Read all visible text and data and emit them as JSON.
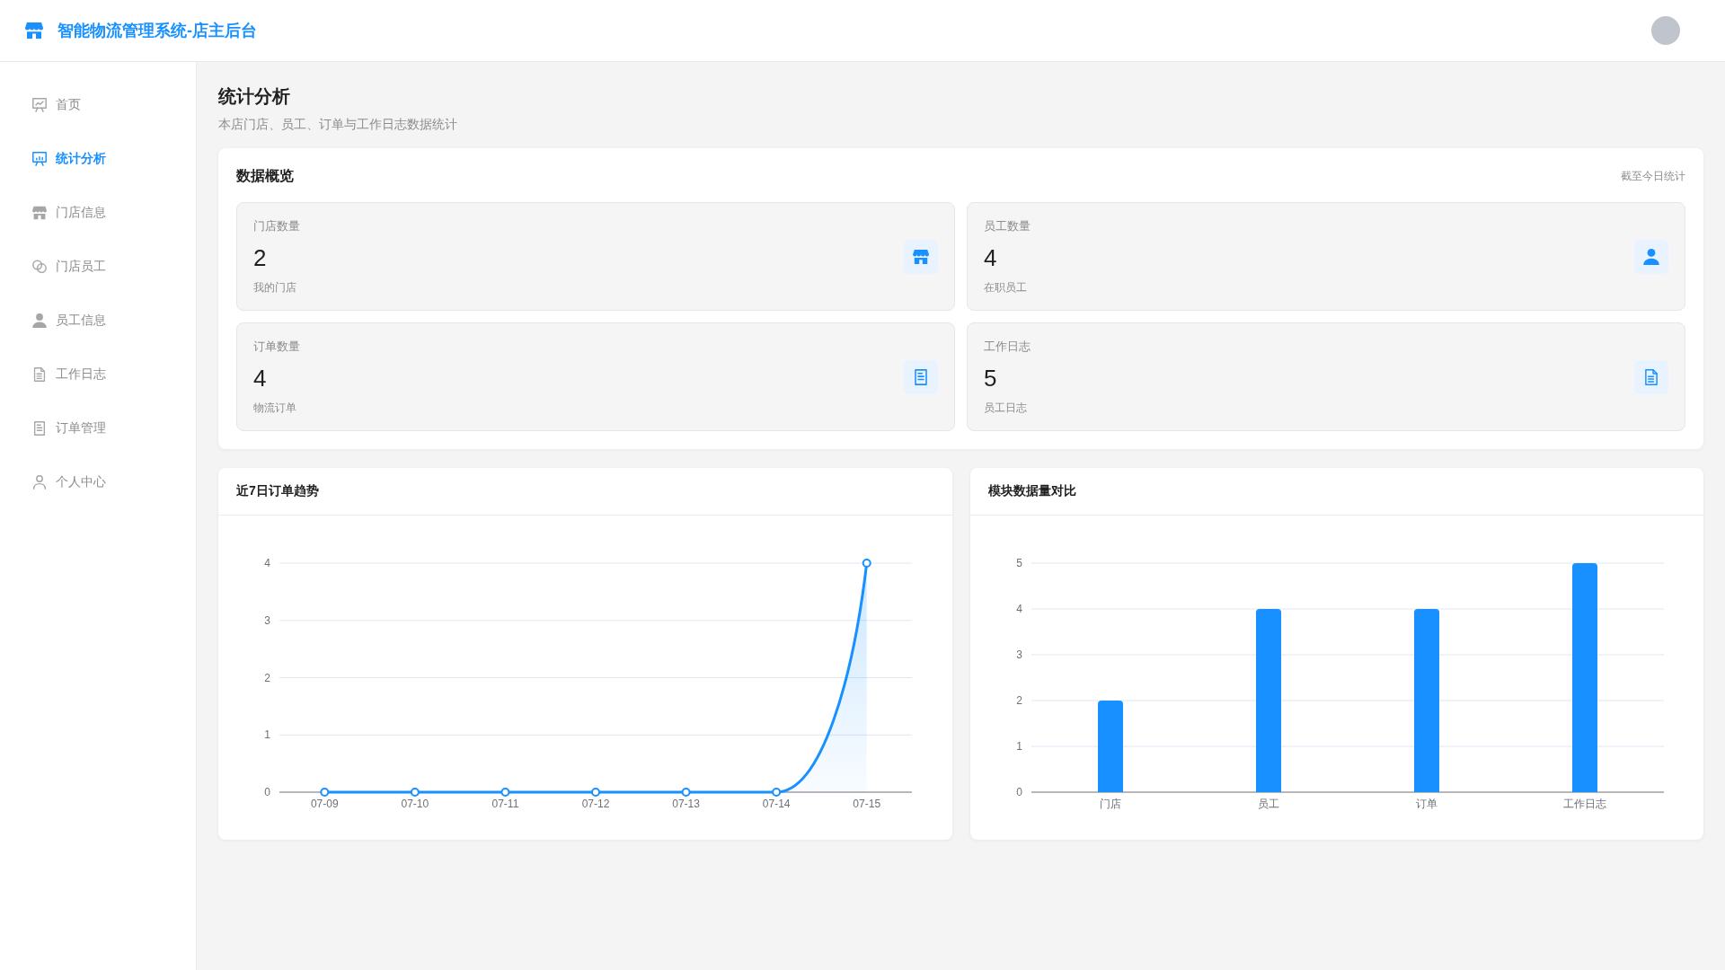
{
  "header": {
    "title": "智能物流管理系统-店主后台"
  },
  "sidebar": {
    "items": [
      {
        "label": "首页",
        "selected": false
      },
      {
        "label": "统计分析",
        "selected": true
      },
      {
        "label": "门店信息",
        "selected": false
      },
      {
        "label": "门店员工",
        "selected": false
      },
      {
        "label": "员工信息",
        "selected": false
      },
      {
        "label": "工作日志",
        "selected": false
      },
      {
        "label": "订单管理",
        "selected": false
      },
      {
        "label": "个人中心",
        "selected": false
      }
    ]
  },
  "page": {
    "title": "统计分析",
    "subtitle": "本店门店、员工、订单与工作日志数据统计"
  },
  "overview": {
    "title": "数据概览",
    "note": "截至今日统计",
    "stats": [
      {
        "label": "门店数量",
        "value": "2",
        "caption": "我的门店"
      },
      {
        "label": "员工数量",
        "value": "4",
        "caption": "在职员工"
      },
      {
        "label": "订单数量",
        "value": "4",
        "caption": "物流订单"
      },
      {
        "label": "工作日志",
        "value": "5",
        "caption": "员工日志"
      }
    ]
  },
  "charts": [
    {
      "title": "近7日订单趋势",
      "chart_data": {
        "type": "area",
        "categories": [
          "07-09",
          "07-10",
          "07-11",
          "07-12",
          "07-13",
          "07-14",
          "07-15"
        ],
        "series": [
          {
            "color": "#1890ff",
            "marker": "circle",
            "values": [
              0,
              0,
              0,
              0,
              0,
              0,
              4
            ]
          }
        ],
        "ylim": [
          0,
          4
        ],
        "yticks": [
          0,
          1,
          2,
          3,
          4
        ],
        "grid": true
      }
    },
    {
      "title": "模块数据量对比",
      "chart_data": {
        "type": "bar",
        "categories": [
          "门店",
          "员工",
          "订单",
          "工作日志"
        ],
        "series": [
          {
            "color": "#1890ff",
            "values": [
              2,
              4,
              4,
              5
            ]
          }
        ],
        "ylim": [
          0,
          5
        ],
        "yticks": [
          0,
          1,
          2,
          3,
          4,
          5
        ],
        "grid": true
      }
    }
  ]
}
